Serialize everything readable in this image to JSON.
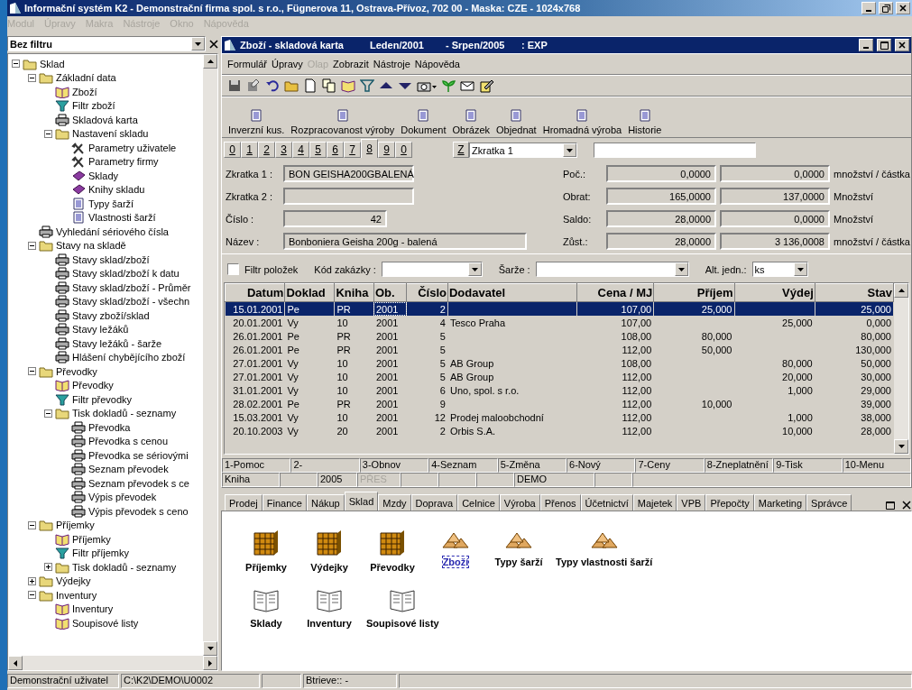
{
  "window": {
    "title": "Informační systém K2 - Demonstrační firma spol. s r.o., Fügnerova 11, Ostrava-Přívoz, 702 00 - Maska: CZE - 1024x768"
  },
  "menu": [
    "Modul",
    "Úpravy",
    "Makra",
    "Nástroje",
    "Okno",
    "Nápověda"
  ],
  "sidebar": {
    "filter": "Bez filtru",
    "tree": [
      {
        "label": "Sklad",
        "kind": "folder",
        "expanded": true,
        "children": [
          {
            "label": "Základní data",
            "kind": "folder",
            "expanded": true,
            "children": [
              {
                "label": "Zboží",
                "kind": "book"
              },
              {
                "label": "Filtr zboží",
                "kind": "filter"
              },
              {
                "label": "Skladová karta",
                "kind": "printer"
              },
              {
                "label": "Nastavení skladu",
                "kind": "folder",
                "expanded": true,
                "children": [
                  {
                    "label": "Parametry uživatele",
                    "kind": "tools"
                  },
                  {
                    "label": "Parametry firmy",
                    "kind": "tools"
                  },
                  {
                    "label": "Sklady",
                    "kind": "volume"
                  },
                  {
                    "label": "Knihy skladu",
                    "kind": "volume"
                  },
                  {
                    "label": "Typy šarží",
                    "kind": "doc"
                  },
                  {
                    "label": "Vlastnosti šarží",
                    "kind": "doc"
                  }
                ]
              }
            ]
          },
          {
            "label": "Vyhledání sériového čísla",
            "kind": "printer"
          },
          {
            "label": "Stavy na skladě",
            "kind": "folder",
            "expanded": true,
            "children": [
              {
                "label": "Stavy sklad/zboží",
                "kind": "printer"
              },
              {
                "label": "Stavy sklad/zboží k datu",
                "kind": "printer"
              },
              {
                "label": "Stavy sklad/zboží - Průměr",
                "kind": "printer"
              },
              {
                "label": "Stavy sklad/zboží - všechn",
                "kind": "printer"
              },
              {
                "label": "Stavy zboží/sklad",
                "kind": "printer"
              },
              {
                "label": "Stavy ležáků",
                "kind": "printer"
              },
              {
                "label": "Stavy ležáků - šarže",
                "kind": "printer"
              },
              {
                "label": "Hlášení chybějícího zboží",
                "kind": "printer"
              }
            ]
          },
          {
            "label": "Převodky",
            "kind": "folder",
            "expanded": true,
            "children": [
              {
                "label": "Převodky",
                "kind": "book"
              },
              {
                "label": "Filtr převodky",
                "kind": "filter"
              },
              {
                "label": "Tisk dokladů - seznamy",
                "kind": "folder",
                "expanded": true,
                "children": [
                  {
                    "label": "Převodka",
                    "kind": "printer"
                  },
                  {
                    "label": "Převodka s cenou",
                    "kind": "printer"
                  },
                  {
                    "label": "Převodka se sériovými",
                    "kind": "printer"
                  },
                  {
                    "label": "Seznam převodek",
                    "kind": "printer"
                  },
                  {
                    "label": "Seznam převodek s ce",
                    "kind": "printer"
                  },
                  {
                    "label": "Výpis převodek",
                    "kind": "printer"
                  },
                  {
                    "label": "Výpis převodek s ceno",
                    "kind": "printer"
                  }
                ]
              }
            ]
          },
          {
            "label": "Příjemky",
            "kind": "folder",
            "expanded": true,
            "children": [
              {
                "label": "Příjemky",
                "kind": "book"
              },
              {
                "label": "Filtr příjemky",
                "kind": "filter"
              },
              {
                "label": "Tisk dokladů - seznamy",
                "kind": "folder",
                "expanded": false
              }
            ]
          },
          {
            "label": "Výdejky",
            "kind": "folder",
            "expanded": false
          },
          {
            "label": "Inventury",
            "kind": "folder",
            "expanded": true,
            "children": [
              {
                "label": "Inventury",
                "kind": "book"
              },
              {
                "label": "Soupisové listy",
                "kind": "book"
              }
            ]
          }
        ]
      }
    ]
  },
  "card": {
    "title_parts": [
      "Zboží - skladová karta",
      "Leden/2001",
      "- Srpen/2005",
      ": EXP"
    ],
    "menu": [
      {
        "label": "Formulář",
        "disabled": false
      },
      {
        "label": "Úpravy",
        "disabled": false
      },
      {
        "label": "Olap",
        "disabled": true
      },
      {
        "label": "Zobrazit",
        "disabled": false
      },
      {
        "label": "Nástroje",
        "disabled": false
      },
      {
        "label": "Nápověda",
        "disabled": false
      }
    ],
    "actions": [
      "Inverzní kus.",
      "Rozpracovanost výroby",
      "Dokument",
      "Obrázek",
      "Objednat",
      "Hromadná výroba",
      "Historie"
    ],
    "page_tabs": [
      {
        "label": "0",
        "selected": false
      },
      {
        "label": "1",
        "selected": false
      },
      {
        "label": "2",
        "selected": false
      },
      {
        "label": "3",
        "selected": false
      },
      {
        "label": "4",
        "selected": false
      },
      {
        "label": "5",
        "selected": false
      },
      {
        "label": "6",
        "selected": false
      },
      {
        "label": "7",
        "selected": false
      },
      {
        "label": "8",
        "selected": true
      },
      {
        "label": "9",
        "selected": false
      },
      {
        "label": "0",
        "selected": false
      }
    ],
    "sort": {
      "button": "Z",
      "field": "Zkratka 1"
    },
    "fields_left": [
      {
        "label": "Zkratka 1 :",
        "kind": "text",
        "value": "BON GEISHA200GBALENÁ"
      },
      {
        "label": "Zkratka 2 :",
        "kind": "text"
      },
      {
        "label": "Číslo :",
        "kind": "number",
        "value": "42"
      },
      {
        "label": "Název :",
        "kind": "wide",
        "value": "Bonboniera Geisha 200g - balená"
      }
    ],
    "fields_right": [
      {
        "label": "Poč.:",
        "values": [
          "0,0000",
          "0,0000"
        ],
        "unit": "množství / částka"
      },
      {
        "label": "Obrat:",
        "values": [
          "165,0000",
          "137,0000"
        ],
        "unit": "Množství"
      },
      {
        "label": "Saldo:",
        "values": [
          "28,0000",
          "0,0000"
        ],
        "unit": "Množství"
      },
      {
        "label": "Zůst.:",
        "values": [
          "28,0000",
          "3 136,0008"
        ],
        "unit": "množství / částka"
      }
    ],
    "filter": {
      "checkbox": {
        "label": "Filtr položek",
        "checked": false
      },
      "combos": [
        {
          "label": "Kód zakázky :"
        },
        {
          "label": "Šarže :"
        },
        {
          "label": "Alt. jedn.:",
          "value": "ks"
        }
      ]
    },
    "table": {
      "columns": [
        "Datum",
        "Doklad",
        "Kniha",
        "Ob.",
        "Číslo",
        "Dodavatel",
        "Cena / MJ",
        "Příjem",
        "Výdej",
        "Stav"
      ],
      "rows": [
        {
          "selected": true,
          "datum": "15.01.2001",
          "doklad": "Pe",
          "kniha": "PR",
          "ob": "2001",
          "cislo": "2",
          "cena": "107,00",
          "prijem": "25,000",
          "stav": "25,000"
        },
        {
          "selected": false,
          "datum": "20.01.2001",
          "doklad": "Vy",
          "kniha": "10",
          "ob": "2001",
          "cislo": "4",
          "dodavatel": "Tesco Praha",
          "cena": "107,00",
          "vydej": "25,000",
          "stav": "0,000"
        },
        {
          "selected": false,
          "datum": "26.01.2001",
          "doklad": "Pe",
          "kniha": "PR",
          "ob": "2001",
          "cislo": "5",
          "cena": "108,00",
          "prijem": "80,000",
          "stav": "80,000"
        },
        {
          "selected": false,
          "datum": "26.01.2001",
          "doklad": "Pe",
          "kniha": "PR",
          "ob": "2001",
          "cislo": "5",
          "cena": "112,00",
          "prijem": "50,000",
          "stav": "130,000"
        },
        {
          "selected": false,
          "datum": "27.01.2001",
          "doklad": "Vy",
          "kniha": "10",
          "ob": "2001",
          "cislo": "5",
          "dodavatel": "AB Group",
          "cena": "108,00",
          "vydej": "80,000",
          "stav": "50,000"
        },
        {
          "selected": false,
          "datum": "27.01.2001",
          "doklad": "Vy",
          "kniha": "10",
          "ob": "2001",
          "cislo": "5",
          "dodavatel": "AB Group",
          "cena": "112,00",
          "vydej": "20,000",
          "stav": "30,000"
        },
        {
          "selected": false,
          "datum": "31.01.2001",
          "doklad": "Vy",
          "kniha": "10",
          "ob": "2001",
          "cislo": "6",
          "dodavatel": "Uno, spol. s r.o.",
          "cena": "112,00",
          "vydej": "1,000",
          "stav": "29,000"
        },
        {
          "selected": false,
          "datum": "28.02.2001",
          "doklad": "Pe",
          "kniha": "PR",
          "ob": "2001",
          "cislo": "9",
          "cena": "112,00",
          "prijem": "10,000",
          "stav": "39,000"
        },
        {
          "selected": false,
          "datum": "15.03.2001",
          "doklad": "Vy",
          "kniha": "10",
          "ob": "2001",
          "cislo": "12",
          "dodavatel": "Prodej maloobchodní",
          "cena": "112,00",
          "vydej": "1,000",
          "stav": "38,000"
        },
        {
          "selected": false,
          "datum": "20.10.2003",
          "doklad": "Vy",
          "kniha": "20",
          "ob": "2001",
          "cislo": "2",
          "dodavatel": "Orbis S.A.",
          "cena": "112,00",
          "vydej": "10,000",
          "stav": "28,000"
        }
      ]
    },
    "function_keys": [
      "1-Pomoc",
      "2-",
      "3-Obnov",
      "4-Seznam",
      "5-Změna",
      "6-Nový",
      "7-Ceny",
      "8-Zneplatnění",
      "9-Tisk",
      "10-Menu"
    ],
    "status_cells": [
      {
        "kind": "text",
        "text": "Kniha",
        "disabled": false
      },
      {
        "kind": "blank"
      },
      {
        "kind": "text",
        "text": "2005",
        "disabled": false
      },
      {
        "kind": "text",
        "text": "PŘES",
        "disabled": true
      },
      {
        "kind": "blank"
      },
      {
        "kind": "blank"
      },
      {
        "kind": "blank"
      },
      {
        "kind": "text",
        "text": "DEMO",
        "disabled": false
      },
      {
        "kind": "blank"
      },
      {
        "kind": "blank"
      }
    ]
  },
  "module_tabs": [
    {
      "label": "Prodej",
      "selected": false
    },
    {
      "label": "Finance",
      "selected": false
    },
    {
      "label": "Nákup",
      "selected": false
    },
    {
      "label": "Sklad",
      "selected": true
    },
    {
      "label": "Mzdy",
      "selected": false
    },
    {
      "label": "Doprava",
      "selected": false
    },
    {
      "label": "Celnice",
      "selected": false
    },
    {
      "label": "Výroba",
      "selected": false
    },
    {
      "label": "Přenos",
      "selected": false
    },
    {
      "label": "Účetnictví",
      "selected": false
    },
    {
      "label": "Majetek",
      "selected": false
    },
    {
      "label": "VPB",
      "selected": false
    },
    {
      "label": "Přepočty",
      "selected": false
    },
    {
      "label": "Marketing",
      "selected": false
    },
    {
      "label": "Správce",
      "selected": false
    }
  ],
  "launcher": {
    "rows": [
      {
        "items": [
          {
            "label": "Příjemky",
            "kind": "stack",
            "selected": false
          },
          {
            "label": "Výdejky",
            "kind": "stack",
            "selected": false
          },
          {
            "label": "Převodky",
            "kind": "stack",
            "selected": false
          },
          {
            "label": "Zboží",
            "kind": "piles",
            "selected": true
          },
          {
            "label": "Typy šarží",
            "kind": "piles",
            "selected": false
          },
          {
            "label": "Typy vlastnosti šarží",
            "kind": "piles",
            "selected": false
          }
        ]
      },
      {
        "items": [
          {
            "label": "Sklady",
            "kind": "book",
            "selected": false
          },
          {
            "label": "Inventury",
            "kind": "book",
            "selected": false
          },
          {
            "label": "Soupisové listy",
            "kind": "book",
            "selected": false
          }
        ]
      }
    ]
  },
  "status_bar": [
    {
      "kind": "text",
      "text": "Demonstrační uživatel"
    },
    {
      "kind": "text",
      "text": "C:\\K2\\DEMO\\U0002"
    },
    {
      "kind": "blank"
    },
    {
      "kind": "text",
      "text": "Btrieve:: -"
    },
    {
      "kind": "blank"
    }
  ]
}
